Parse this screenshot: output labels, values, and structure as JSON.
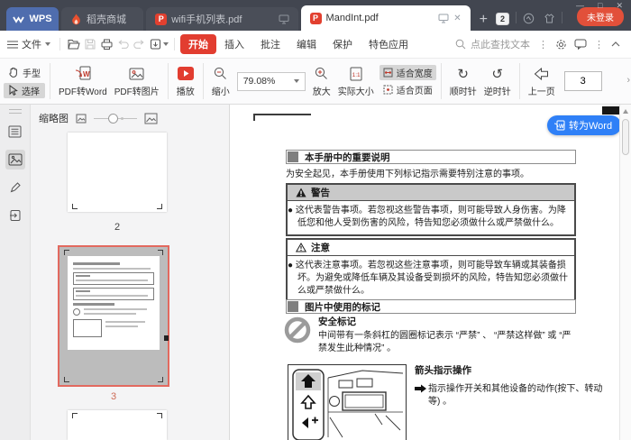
{
  "window": {
    "controls": {
      "minimize": "—",
      "maximize": "□",
      "close": "✕"
    }
  },
  "tabbar": {
    "wps_label": "WPS",
    "tabs": [
      {
        "label": "稻壳商城"
      },
      {
        "label": "wifi手机列表.pdf"
      },
      {
        "label": "MandInt.pdf"
      }
    ],
    "new_tab": "+",
    "tab_count": "2",
    "login_label": "未登录"
  },
  "menubar": {
    "file_label": "文件",
    "tabs": [
      "开始",
      "插入",
      "批注",
      "编辑",
      "保护",
      "特色应用"
    ],
    "search_placeholder": "点此查找文本"
  },
  "toolbar": {
    "hand": "手型",
    "select": "选择",
    "pdf_to_word": "PDF转Word",
    "pdf_to_image": "PDF转图片",
    "play": "播放",
    "zoom_out": "缩小",
    "zoom_value": "79.08%",
    "zoom_in": "放大",
    "actual_size": "实际大小",
    "fit_width": "适合宽度",
    "fit_page": "适合页面",
    "rotate_cw": "顺时针",
    "rotate_ccw": "逆时针",
    "prev_page": "上一页",
    "page_value": "3",
    "overflow": "›"
  },
  "sidebar": {
    "panel_title": "缩略图",
    "thumbnails": [
      {
        "page": "2"
      },
      {
        "page": "3"
      }
    ]
  },
  "document": {
    "convert_button": "转为Word",
    "section1_title": "本手册中的重要说明",
    "intro": "为安全起见，本手册使用下列标记指示需要特别注意的事项。",
    "warning_title": "警告",
    "warning_text": "● 这代表警告事项。若忽视这些警告事项，则可能导致人身伤害。为降低您和他人受到伤害的风险，特告知您必须做什么或严禁做什么。",
    "caution_title": "注意",
    "caution_text": "● 这代表注意事项。若忽视这些注意事项，则可能导致车辆或其装备损坏。为避免或降低车辆及其设备受到损坏的风险，特告知您必须做什么或严禁做什么。",
    "section2_title": "图片中使用的标记",
    "safety_title": "安全标记",
    "safety_text": "中间带有一条斜杠的圆圈标记表示 “严禁” 、 “严禁这样做” 或 “严禁发生此种情况” 。",
    "arrow_title": "箭头指示操作",
    "arrow_text": "指示操作开关和其他设备的动作(按下、转动等) 。"
  },
  "colors": {
    "accent_red": "#e23d30",
    "accent_blue": "#2f80f7",
    "thumb_selected_border": "#e2695f",
    "login_pill": "#e2503a"
  }
}
